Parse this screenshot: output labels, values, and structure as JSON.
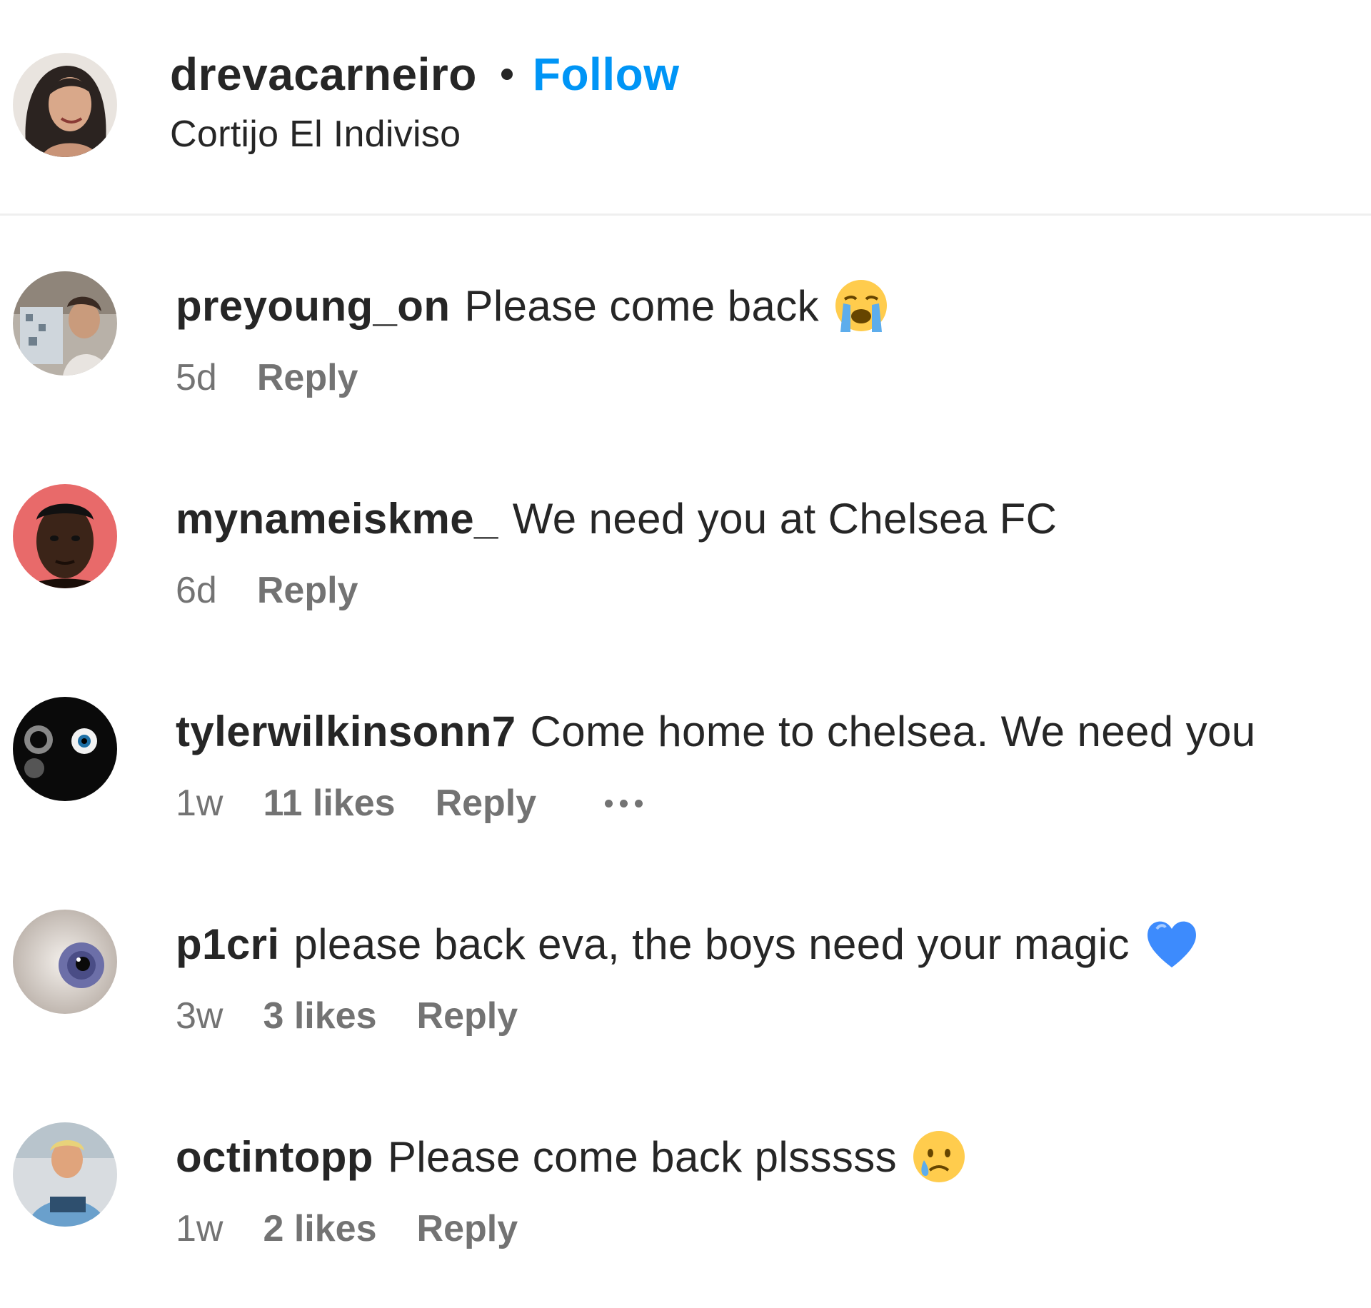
{
  "post_header": {
    "username": "drevacarneiro",
    "follow_label": "Follow",
    "location": "Cortijo El Indiviso"
  },
  "comments": [
    {
      "username": "preyoung_on",
      "text": "Please come back",
      "emoji": "loudly-crying-face-emoji",
      "time": "5d",
      "likes": "",
      "reply_label": "Reply"
    },
    {
      "username": "mynameiskme_",
      "text": "We need you at Chelsea FC",
      "emoji": "",
      "time": "6d",
      "likes": "",
      "reply_label": "Reply"
    },
    {
      "username": "tylerwilkinsonn7",
      "text": "Come home to chelsea. We need you",
      "emoji": "",
      "time": "1w",
      "likes": "11 likes",
      "reply_label": "Reply",
      "more_options": "more-options-icon"
    },
    {
      "username": "p1cri",
      "text": "please back eva, the boys need your magic",
      "emoji": "blue-heart-emoji",
      "time": "3w",
      "likes": "3 likes",
      "reply_label": "Reply"
    },
    {
      "username": "octintopp",
      "text": "Please come back plsssss",
      "emoji": "crying-face-emoji",
      "time": "1w",
      "likes": "2 likes",
      "reply_label": "Reply"
    }
  ],
  "colors": {
    "text": "#262626",
    "meta": "#737373",
    "follow": "#0095f6",
    "divider": "#efefef"
  }
}
